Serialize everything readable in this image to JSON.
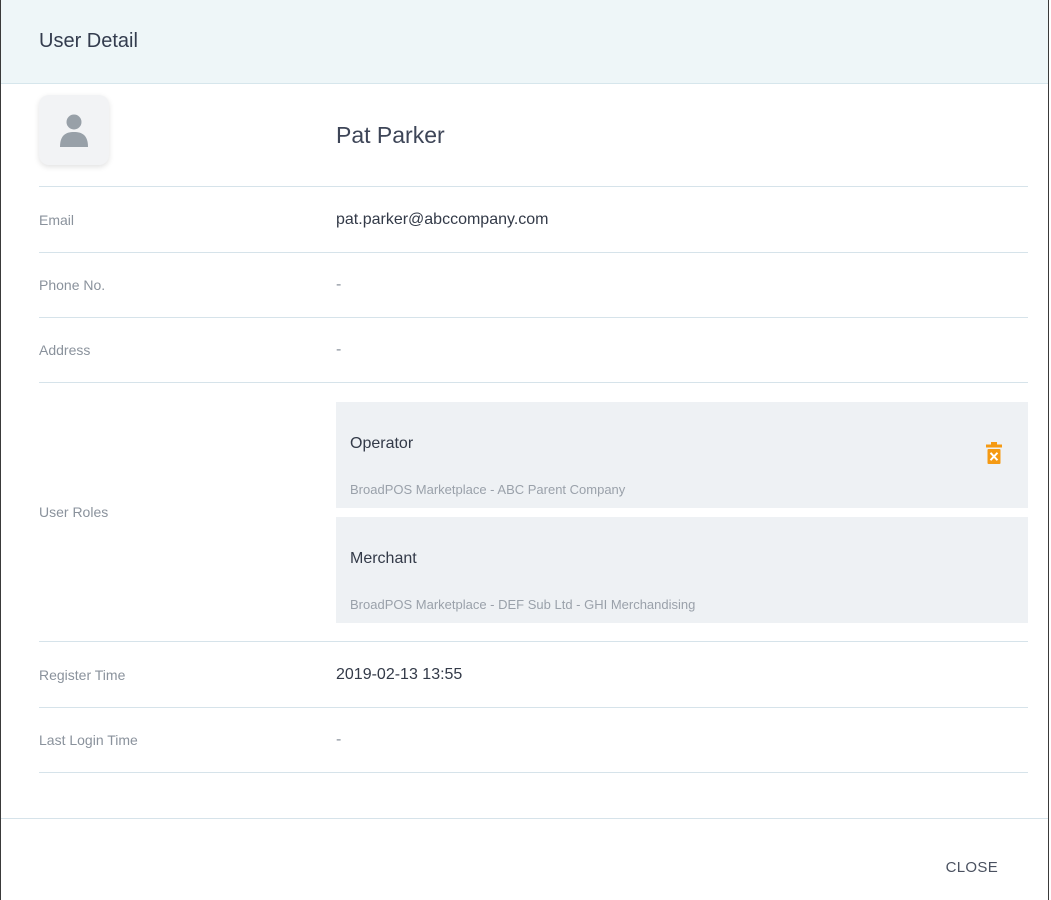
{
  "dialog": {
    "title": "User Detail"
  },
  "user": {
    "avatar_icon": "user-silhouette-icon",
    "name": "Pat Parker"
  },
  "fields": {
    "email": {
      "label": "Email",
      "value": "pat.parker@abccompany.com"
    },
    "phone": {
      "label": "Phone No.",
      "value": "-"
    },
    "address": {
      "label": "Address",
      "value": "-"
    },
    "roles_label": "User Roles",
    "register_time": {
      "label": "Register Time",
      "value": "2019-02-13 13:55"
    },
    "last_login_time": {
      "label": "Last Login Time",
      "value": "-"
    }
  },
  "roles": [
    {
      "name": "Operator",
      "scope": "BroadPOS Marketplace - ABC Parent Company",
      "delete_icon": "trash-icon"
    },
    {
      "name": "Merchant",
      "scope": "BroadPOS Marketplace - DEF Sub Ltd - GHI Merchandising"
    }
  ],
  "footer": {
    "close_label": "CLOSE"
  },
  "colors": {
    "header_bg": "#eef6f8",
    "role_card_bg": "#eef1f4",
    "delete_accent": "#f59a13"
  }
}
